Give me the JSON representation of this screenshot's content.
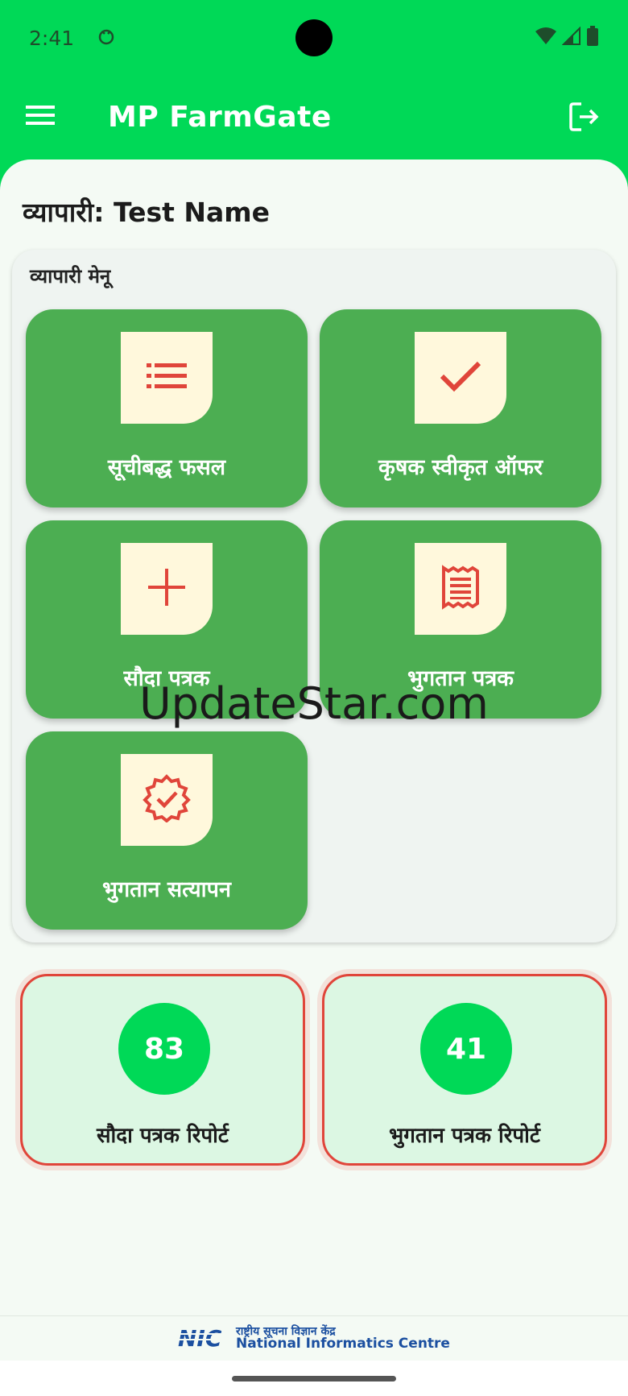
{
  "status_bar": {
    "time": "2:41"
  },
  "app_bar": {
    "title": "MP FarmGate"
  },
  "trader": {
    "line": "व्यापारी: Test Name"
  },
  "menu": {
    "title": "व्यापारी मेनू",
    "tiles": [
      {
        "label": "सूचीबद्ध फसल",
        "icon": "list-icon"
      },
      {
        "label": "कृषक स्वीकृत ऑफर",
        "icon": "check-icon"
      },
      {
        "label": "सौदा पत्रक",
        "icon": "plus-icon"
      },
      {
        "label": "भुगतान पत्रक",
        "icon": "receipt-icon"
      },
      {
        "label": "भुगतान सत्यापन",
        "icon": "verified-badge-icon"
      }
    ]
  },
  "reports": [
    {
      "count": "83",
      "label": "सौदा पत्रक रिपोर्ट"
    },
    {
      "count": "41",
      "label": "भुगतान पत्रक रिपोर्ट"
    }
  ],
  "watermark": "UpdateStar.com",
  "footer": {
    "logo": "NIC",
    "hindi": "राष्ट्रीय सूचना विज्ञान केंद्र",
    "english": "National Informatics Centre"
  },
  "colors": {
    "primary": "#00d957",
    "tile": "#4cae52",
    "icon_box": "#fff8dc",
    "icon": "#e0453a",
    "report_bg": "#dcf7e3"
  }
}
